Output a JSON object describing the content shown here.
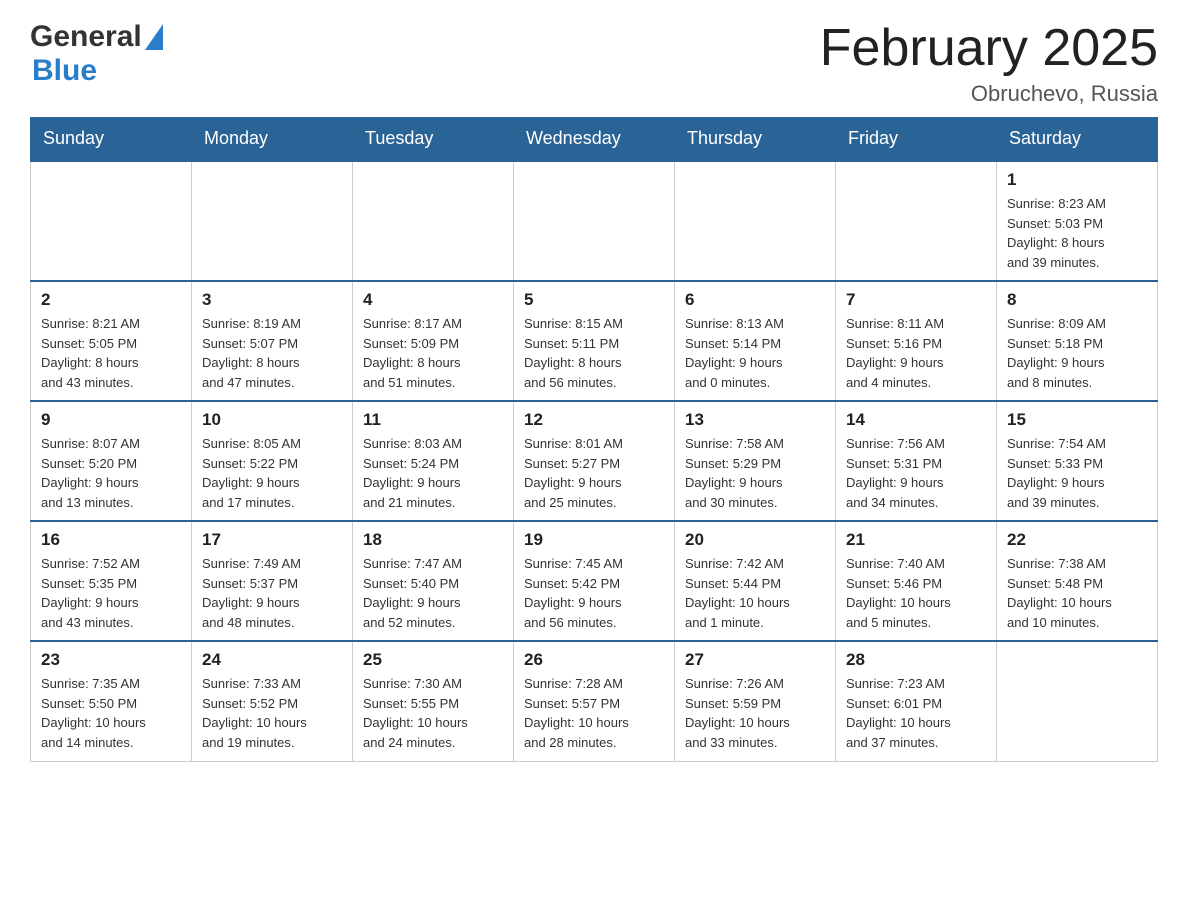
{
  "header": {
    "month_title": "February 2025",
    "location": "Obruchevo, Russia",
    "logo_general": "General",
    "logo_blue": "Blue"
  },
  "weekdays": [
    "Sunday",
    "Monday",
    "Tuesday",
    "Wednesday",
    "Thursday",
    "Friday",
    "Saturday"
  ],
  "weeks": [
    [
      {
        "day": "",
        "info": ""
      },
      {
        "day": "",
        "info": ""
      },
      {
        "day": "",
        "info": ""
      },
      {
        "day": "",
        "info": ""
      },
      {
        "day": "",
        "info": ""
      },
      {
        "day": "",
        "info": ""
      },
      {
        "day": "1",
        "info": "Sunrise: 8:23 AM\nSunset: 5:03 PM\nDaylight: 8 hours\nand 39 minutes."
      }
    ],
    [
      {
        "day": "2",
        "info": "Sunrise: 8:21 AM\nSunset: 5:05 PM\nDaylight: 8 hours\nand 43 minutes."
      },
      {
        "day": "3",
        "info": "Sunrise: 8:19 AM\nSunset: 5:07 PM\nDaylight: 8 hours\nand 47 minutes."
      },
      {
        "day": "4",
        "info": "Sunrise: 8:17 AM\nSunset: 5:09 PM\nDaylight: 8 hours\nand 51 minutes."
      },
      {
        "day": "5",
        "info": "Sunrise: 8:15 AM\nSunset: 5:11 PM\nDaylight: 8 hours\nand 56 minutes."
      },
      {
        "day": "6",
        "info": "Sunrise: 8:13 AM\nSunset: 5:14 PM\nDaylight: 9 hours\nand 0 minutes."
      },
      {
        "day": "7",
        "info": "Sunrise: 8:11 AM\nSunset: 5:16 PM\nDaylight: 9 hours\nand 4 minutes."
      },
      {
        "day": "8",
        "info": "Sunrise: 8:09 AM\nSunset: 5:18 PM\nDaylight: 9 hours\nand 8 minutes."
      }
    ],
    [
      {
        "day": "9",
        "info": "Sunrise: 8:07 AM\nSunset: 5:20 PM\nDaylight: 9 hours\nand 13 minutes."
      },
      {
        "day": "10",
        "info": "Sunrise: 8:05 AM\nSunset: 5:22 PM\nDaylight: 9 hours\nand 17 minutes."
      },
      {
        "day": "11",
        "info": "Sunrise: 8:03 AM\nSunset: 5:24 PM\nDaylight: 9 hours\nand 21 minutes."
      },
      {
        "day": "12",
        "info": "Sunrise: 8:01 AM\nSunset: 5:27 PM\nDaylight: 9 hours\nand 25 minutes."
      },
      {
        "day": "13",
        "info": "Sunrise: 7:58 AM\nSunset: 5:29 PM\nDaylight: 9 hours\nand 30 minutes."
      },
      {
        "day": "14",
        "info": "Sunrise: 7:56 AM\nSunset: 5:31 PM\nDaylight: 9 hours\nand 34 minutes."
      },
      {
        "day": "15",
        "info": "Sunrise: 7:54 AM\nSunset: 5:33 PM\nDaylight: 9 hours\nand 39 minutes."
      }
    ],
    [
      {
        "day": "16",
        "info": "Sunrise: 7:52 AM\nSunset: 5:35 PM\nDaylight: 9 hours\nand 43 minutes."
      },
      {
        "day": "17",
        "info": "Sunrise: 7:49 AM\nSunset: 5:37 PM\nDaylight: 9 hours\nand 48 minutes."
      },
      {
        "day": "18",
        "info": "Sunrise: 7:47 AM\nSunset: 5:40 PM\nDaylight: 9 hours\nand 52 minutes."
      },
      {
        "day": "19",
        "info": "Sunrise: 7:45 AM\nSunset: 5:42 PM\nDaylight: 9 hours\nand 56 minutes."
      },
      {
        "day": "20",
        "info": "Sunrise: 7:42 AM\nSunset: 5:44 PM\nDaylight: 10 hours\nand 1 minute."
      },
      {
        "day": "21",
        "info": "Sunrise: 7:40 AM\nSunset: 5:46 PM\nDaylight: 10 hours\nand 5 minutes."
      },
      {
        "day": "22",
        "info": "Sunrise: 7:38 AM\nSunset: 5:48 PM\nDaylight: 10 hours\nand 10 minutes."
      }
    ],
    [
      {
        "day": "23",
        "info": "Sunrise: 7:35 AM\nSunset: 5:50 PM\nDaylight: 10 hours\nand 14 minutes."
      },
      {
        "day": "24",
        "info": "Sunrise: 7:33 AM\nSunset: 5:52 PM\nDaylight: 10 hours\nand 19 minutes."
      },
      {
        "day": "25",
        "info": "Sunrise: 7:30 AM\nSunset: 5:55 PM\nDaylight: 10 hours\nand 24 minutes."
      },
      {
        "day": "26",
        "info": "Sunrise: 7:28 AM\nSunset: 5:57 PM\nDaylight: 10 hours\nand 28 minutes."
      },
      {
        "day": "27",
        "info": "Sunrise: 7:26 AM\nSunset: 5:59 PM\nDaylight: 10 hours\nand 33 minutes."
      },
      {
        "day": "28",
        "info": "Sunrise: 7:23 AM\nSunset: 6:01 PM\nDaylight: 10 hours\nand 37 minutes."
      },
      {
        "day": "",
        "info": ""
      }
    ]
  ]
}
